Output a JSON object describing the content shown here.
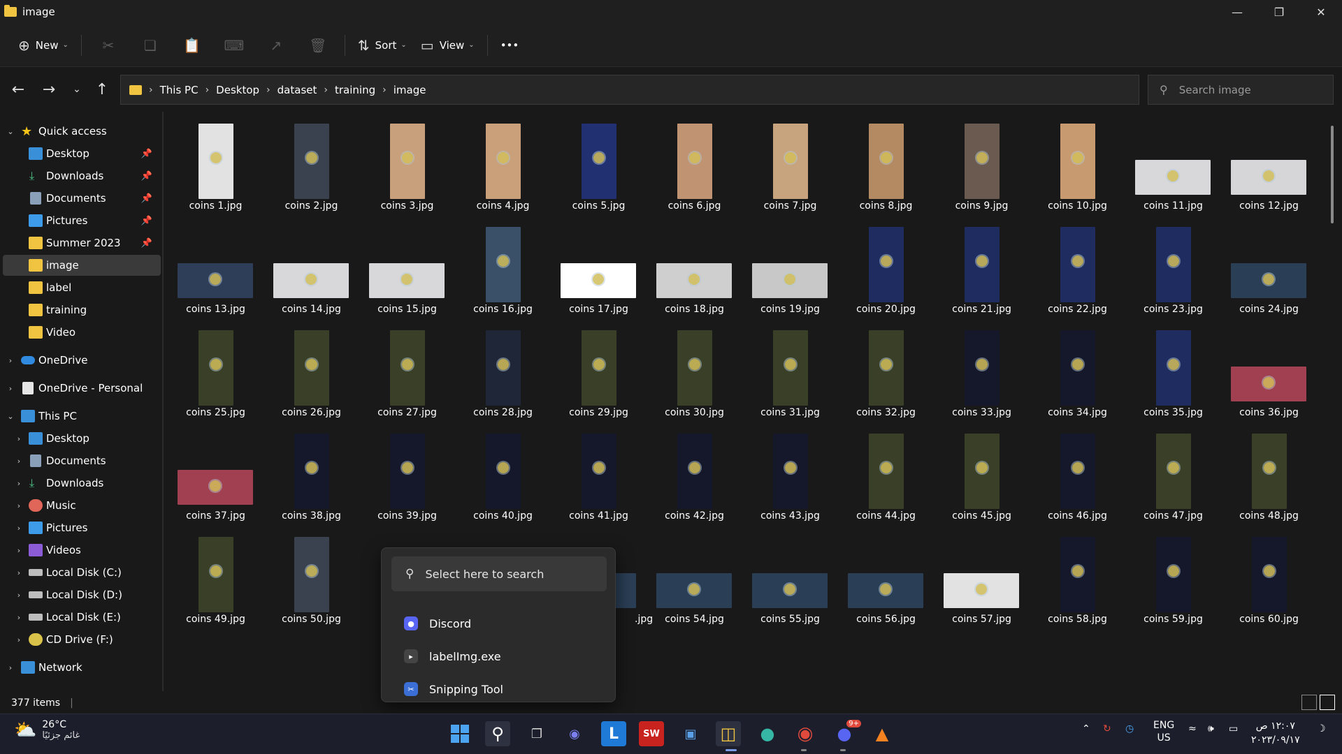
{
  "window": {
    "title": "image",
    "controls": [
      "minimize",
      "maximize",
      "close"
    ]
  },
  "commandbar": {
    "new_label": "New",
    "sort_label": "Sort",
    "view_label": "View",
    "more_label": "•••"
  },
  "address": {
    "breadcrumbs": [
      "This PC",
      "Desktop",
      "dataset",
      "training",
      "image"
    ]
  },
  "search": {
    "placeholder": "Search image"
  },
  "sidebar": {
    "quick_access": "Quick access",
    "qa_items": [
      {
        "label": "Desktop",
        "icon": "desktop-icon"
      },
      {
        "label": "Downloads",
        "icon": "download-icon"
      },
      {
        "label": "Documents",
        "icon": "document-icon"
      },
      {
        "label": "Pictures",
        "icon": "pictures-icon"
      },
      {
        "label": "Summer 2023",
        "icon": "folder-icon"
      },
      {
        "label": "image",
        "icon": "folder-icon"
      },
      {
        "label": "label",
        "icon": "folder-icon"
      },
      {
        "label": "training",
        "icon": "folder-icon"
      },
      {
        "label": "Video",
        "icon": "folder-icon"
      }
    ],
    "onedrive": "OneDrive",
    "onedrive_personal": "OneDrive - Personal",
    "this_pc": "This PC",
    "pc_items": [
      {
        "label": "Desktop"
      },
      {
        "label": "Documents"
      },
      {
        "label": "Downloads"
      },
      {
        "label": "Music"
      },
      {
        "label": "Pictures"
      },
      {
        "label": "Videos"
      },
      {
        "label": "Local Disk (C:)"
      },
      {
        "label": "Local Disk (D:)"
      },
      {
        "label": "Local Disk (E:)"
      },
      {
        "label": "CD Drive (F:)"
      }
    ],
    "network": "Network"
  },
  "files": [
    "coins 1.jpg",
    "coins 2.jpg",
    "coins 3.jpg",
    "coins 4.jpg",
    "coins 5.jpg",
    "coins 6.jpg",
    "coins 7.jpg",
    "coins 8.jpg",
    "coins 9.jpg",
    "coins 10.jpg",
    "coins 11.jpg",
    "coins 12.jpg",
    "coins 13.jpg",
    "coins 14.jpg",
    "coins 15.jpg",
    "coins 16.jpg",
    "coins 17.jpg",
    "coins 18.jpg",
    "coins 19.jpg",
    "coins 20.jpg",
    "coins 21.jpg",
    "coins 22.jpg",
    "coins 23.jpg",
    "coins 24.jpg",
    "coins 25.jpg",
    "coins 26.jpg",
    "coins 27.jpg",
    "coins 28.jpg",
    "coins 29.jpg",
    "coins 30.jpg",
    "coins 31.jpg",
    "coins 32.jpg",
    "coins 33.jpg",
    "coins 34.jpg",
    "coins 35.jpg",
    "coins 36.jpg",
    "coins 37.jpg",
    "coins 38.jpg",
    "coins 39.jpg",
    "coins 40.jpg",
    "coins 41.jpg",
    "coins 42.jpg",
    "coins 43.jpg",
    "coins 44.jpg",
    "coins 45.jpg",
    "coins 46.jpg",
    "coins 47.jpg",
    "coins 48.jpg",
    "coins 49.jpg",
    "coins 50.jpg",
    "",
    "",
    ".jpg",
    "coins 54.jpg",
    "coins 55.jpg",
    "coins 56.jpg",
    "coins 57.jpg",
    "coins 58.jpg",
    "coins 59.jpg",
    "coins 60.jpg"
  ],
  "status": {
    "item_count": "377 items"
  },
  "popup": {
    "search_text": "Select here to search",
    "items": [
      {
        "label": "Discord",
        "color": "#5865f2"
      },
      {
        "label": "labelImg.exe",
        "color": "#444444"
      },
      {
        "label": "Snipping Tool",
        "color": "#3b6fd6"
      }
    ]
  },
  "taskbar": {
    "weather_temp": "26°C",
    "weather_desc": "غائم جزئيًا",
    "lang_top": "ENG",
    "lang_bottom": "US",
    "time": "١٢:٠٧ ص",
    "date": "٢٠٢٣/٠٩/١٧",
    "discord_badge": "9+"
  }
}
